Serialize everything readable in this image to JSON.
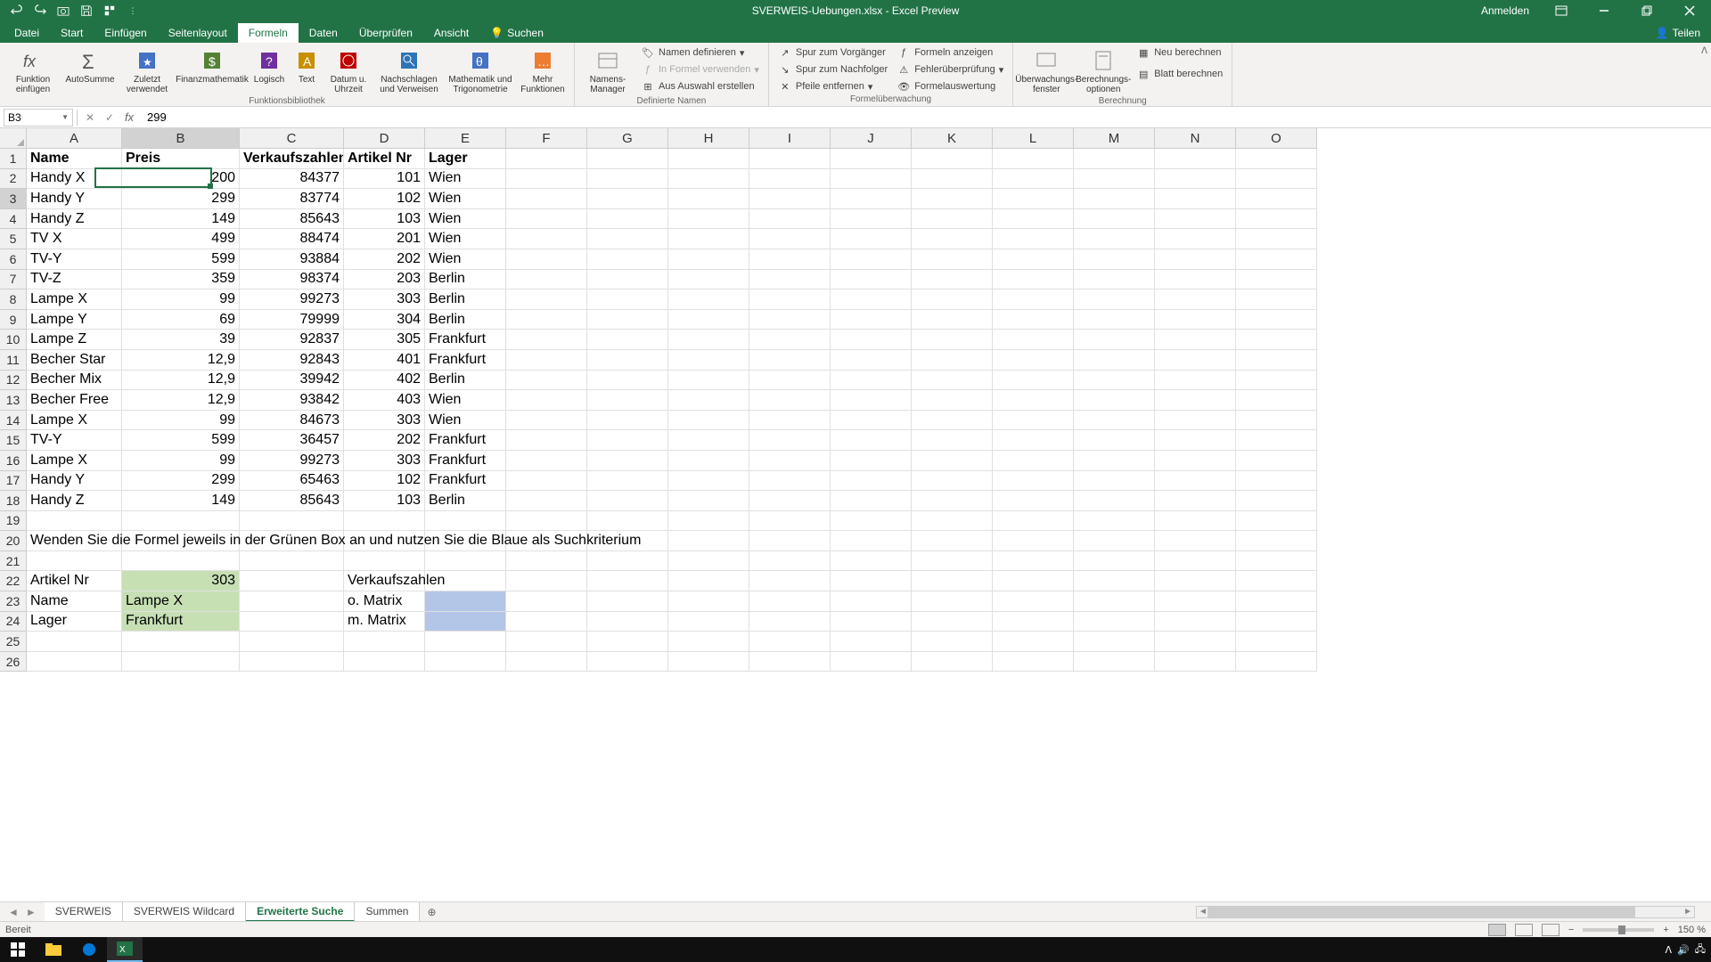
{
  "title": "SVERWEIS-Uebungen.xlsx - Excel Preview",
  "anmelden": "Anmelden",
  "teilen": "Teilen",
  "tabs": [
    "Datei",
    "Start",
    "Einfügen",
    "Seitenlayout",
    "Formeln",
    "Daten",
    "Überprüfen",
    "Ansicht"
  ],
  "active_tab": 4,
  "search": "Suchen",
  "ribbon": {
    "g1": {
      "insert_fn": "Funktion einfügen",
      "autosum": "AutoSumme",
      "recent": "Zuletzt verwendet",
      "financial": "Finanzmathematik",
      "logical": "Logisch",
      "text": "Text",
      "date": "Datum u. Uhrzeit",
      "lookup": "Nachschlagen und Verweisen",
      "math": "Mathematik und Trigonometrie",
      "more": "Mehr Funktionen",
      "label": "Funktionsbibliothek"
    },
    "g2": {
      "manager": "Namens-Manager",
      "define": "Namen definieren",
      "use": "In Formel verwenden",
      "create": "Aus Auswahl erstellen",
      "label": "Definierte Namen"
    },
    "g3": {
      "trace_prec": "Spur zum Vorgänger",
      "trace_dep": "Spur zum Nachfolger",
      "remove": "Pfeile entfernen",
      "show": "Formeln anzeigen",
      "check": "Fehlerüberprüfung",
      "eval": "Formelauswertung",
      "label": "Formelüberwachung"
    },
    "g4": {
      "watch": "Überwachungs-fenster",
      "calc_opt": "Berechnungs-optionen",
      "calc_now": "Neu berechnen",
      "calc_sheet": "Blatt berechnen",
      "label": "Berechnung"
    }
  },
  "namebox": "B3",
  "formula": "299",
  "cols": [
    "A",
    "B",
    "C",
    "D",
    "E",
    "F",
    "G",
    "H",
    "I",
    "J",
    "K",
    "L",
    "M",
    "N",
    "O"
  ],
  "col_widths": [
    "cA",
    "cB",
    "cC",
    "cD",
    "cE",
    "cF",
    "cG",
    "cH",
    "cI",
    "cJ",
    "cK",
    "cL",
    "cM",
    "cN",
    "cO"
  ],
  "headers": {
    "A": "Name",
    "B": "Preis",
    "C": "Verkaufszahlen",
    "D": "Artikel Nr",
    "E": "Lager"
  },
  "rows": [
    {
      "A": "Handy X",
      "B": "200",
      "C": "84377",
      "D": "101",
      "E": "Wien"
    },
    {
      "A": "Handy Y",
      "B": "299",
      "C": "83774",
      "D": "102",
      "E": "Wien"
    },
    {
      "A": "Handy Z",
      "B": "149",
      "C": "85643",
      "D": "103",
      "E": "Wien"
    },
    {
      "A": "TV X",
      "B": "499",
      "C": "88474",
      "D": "201",
      "E": "Wien"
    },
    {
      "A": "TV-Y",
      "B": "599",
      "C": "93884",
      "D": "202",
      "E": "Wien"
    },
    {
      "A": "TV-Z",
      "B": "359",
      "C": "98374",
      "D": "203",
      "E": "Berlin"
    },
    {
      "A": "Lampe X",
      "B": "99",
      "C": "99273",
      "D": "303",
      "E": "Berlin"
    },
    {
      "A": "Lampe Y",
      "B": "69",
      "C": "79999",
      "D": "304",
      "E": "Berlin"
    },
    {
      "A": "Lampe Z",
      "B": "39",
      "C": "92837",
      "D": "305",
      "E": "Frankfurt"
    },
    {
      "A": "Becher Star",
      "B": "12,9",
      "C": "92843",
      "D": "401",
      "E": "Frankfurt"
    },
    {
      "A": "Becher Mix",
      "B": "12,9",
      "C": "39942",
      "D": "402",
      "E": "Berlin"
    },
    {
      "A": "Becher Free",
      "B": "12,9",
      "C": "93842",
      "D": "403",
      "E": "Wien"
    },
    {
      "A": "Lampe X",
      "B": "99",
      "C": "84673",
      "D": "303",
      "E": "Wien"
    },
    {
      "A": "TV-Y",
      "B": "599",
      "C": "36457",
      "D": "202",
      "E": "Frankfurt"
    },
    {
      "A": "Lampe X",
      "B": "99",
      "C": "99273",
      "D": "303",
      "E": "Frankfurt"
    },
    {
      "A": "Handy Y",
      "B": "299",
      "C": "65463",
      "D": "102",
      "E": "Frankfurt"
    },
    {
      "A": "Handy Z",
      "B": "149",
      "C": "85643",
      "D": "103",
      "E": "Berlin"
    }
  ],
  "instruction": "Wenden Sie die Formel jeweils in der Grünen Box an und nutzen Sie die Blaue als Suchkriterium",
  "lookup": {
    "r22": {
      "A": "Artikel Nr",
      "B": "303",
      "D": "Verkaufszahlen"
    },
    "r23": {
      "A": "Name",
      "B": "Lampe X",
      "D": "o. Matrix"
    },
    "r24": {
      "A": "Lager",
      "B": "Frankfurt",
      "D": "m. Matrix"
    }
  },
  "sheets": [
    "SVERWEIS",
    "SVERWEIS Wildcard",
    "Erweiterte Suche",
    "Summen"
  ],
  "active_sheet": 2,
  "status": "Bereit",
  "zoom": "150 %"
}
